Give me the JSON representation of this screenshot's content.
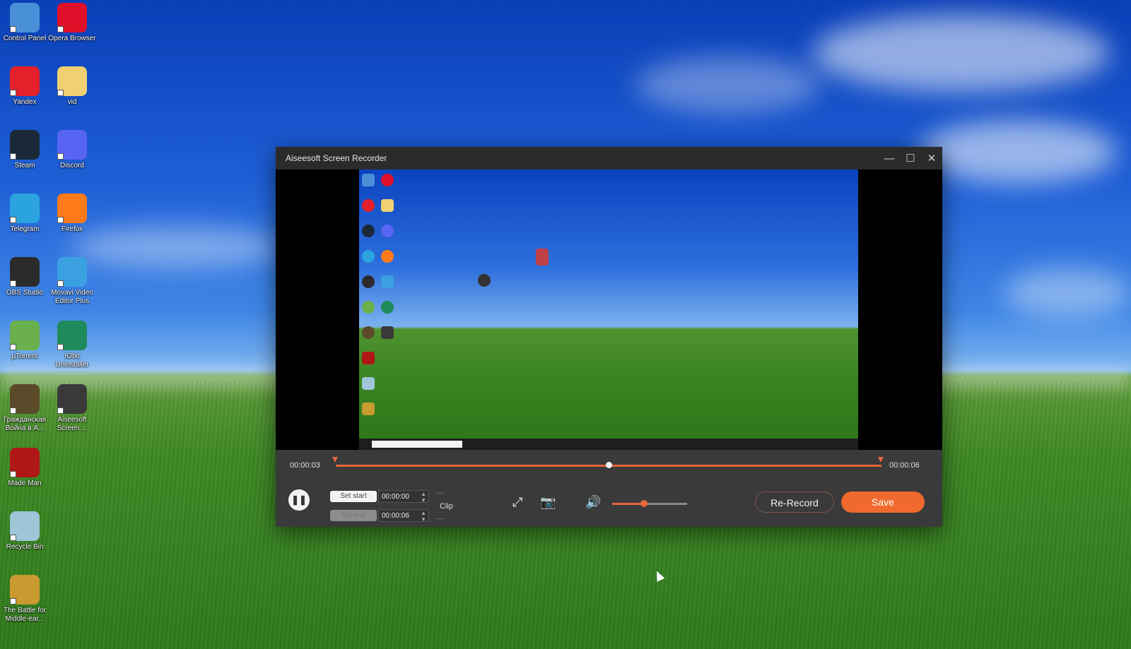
{
  "desktop": {
    "icons": [
      {
        "label": "Control Panel",
        "icon": "control-panel-icon",
        "color": "#4a90d9"
      },
      {
        "label": "Opera Browser",
        "icon": "opera-icon",
        "color": "#e0102b"
      },
      {
        "label": "Yandex",
        "icon": "yandex-icon",
        "color": "#e4212b"
      },
      {
        "label": "vid",
        "icon": "folder-icon",
        "color": "#f0d070"
      },
      {
        "label": "Steam",
        "icon": "steam-icon",
        "color": "#1b2838"
      },
      {
        "label": "Discord",
        "icon": "discord-icon",
        "color": "#5865f2"
      },
      {
        "label": "Telegram",
        "icon": "telegram-icon",
        "color": "#2aa3df"
      },
      {
        "label": "Firefox",
        "icon": "firefox-icon",
        "color": "#ff7a1a"
      },
      {
        "label": "OBS Studio",
        "icon": "obs-icon",
        "color": "#2b2b2b"
      },
      {
        "label": "Movavi Video Editor Plus",
        "icon": "movavi-icon",
        "color": "#3aa0e0"
      },
      {
        "label": "µTorrent",
        "icon": "utorrent-icon",
        "color": "#6ab04c"
      },
      {
        "label": "IObit Uninstaller",
        "icon": "iobit-icon",
        "color": "#1f8a5b"
      },
      {
        "label": "Гражданская Война в А...",
        "icon": "game-icon",
        "color": "#5a4a2a"
      },
      {
        "label": "Aiseesoft Screen ...",
        "icon": "aiseesoft-icon",
        "color": "#3a3a3a"
      },
      {
        "label": "Made Man",
        "icon": "made-man-icon",
        "color": "#b01818"
      },
      {
        "label": "Recycle Bin",
        "icon": "recycle-bin-icon",
        "color": "#9fc6d8"
      },
      {
        "label": "The Battle for Middle-ear...",
        "icon": "battle-icon",
        "color": "#c89a30"
      }
    ]
  },
  "window": {
    "title": "Aiseesoft Screen Recorder",
    "minimize": "—",
    "maximize": "☐",
    "close": "✕"
  },
  "player": {
    "current_time": "00:00:03",
    "total_time": "00:00:06",
    "progress": 0.5,
    "set_start_label": "Set start",
    "set_end_label": "Set end",
    "start_time": "00:00:00",
    "end_time": "00:00:06",
    "clip_label": "Clip",
    "volume": 0.42,
    "rerecord_label": "Re-Record",
    "save_label": "Save",
    "accent": "#ef6a2c"
  }
}
